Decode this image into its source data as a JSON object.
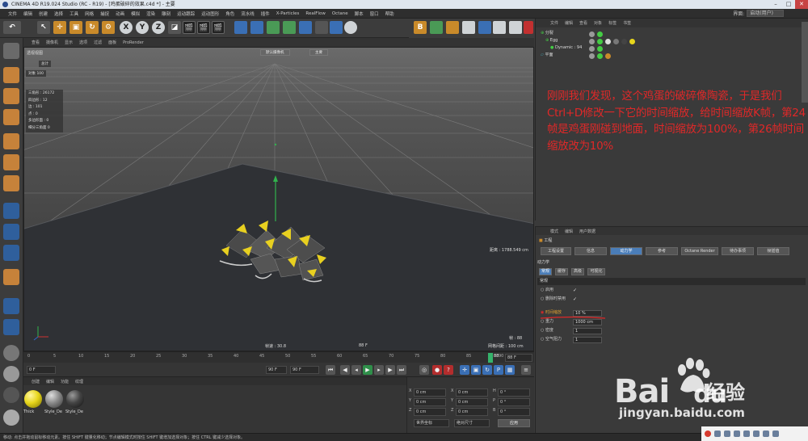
{
  "window": {
    "title": "CINEMA 4D R19.024 Studio (RC - R19) - [鸡蛋破碎的效果.c4d *] - 主要"
  },
  "menubar": {
    "items": [
      "文件",
      "编辑",
      "创建",
      "选择",
      "工具",
      "网格",
      "捕捉",
      "动画",
      "模拟",
      "渲染",
      "雕刻",
      "运动跟踪",
      "运动图形",
      "角色",
      "流水线",
      "插件",
      "X-Particles",
      "RealFlow",
      "Octane",
      "脚本",
      "窗口",
      "帮助"
    ],
    "layout_label": "界面:",
    "layout_value": "启动(用户)"
  },
  "toolbar": {
    "axis_labels": [
      "X",
      "Y",
      "Z"
    ]
  },
  "viewport": {
    "menu": [
      "查看",
      "摄像机",
      "显示",
      "选项",
      "过滤",
      "面板",
      "ProRender"
    ],
    "view_name": "透视视图",
    "camera_button": "默认摄像机",
    "main_button": "主要",
    "hud": {
      "total_label": "总计",
      "objects_label": "对象",
      "objects_value": "100",
      "rows": [
        "三角形 : 26172",
        "四边形 : 12",
        "边 : 101",
        "点 : 0",
        "多边形面 : 0",
        "细分三角面 0"
      ]
    },
    "distance": "距离 : 1788.549 cm",
    "fps": "帧速 : 30.8",
    "frame": "88 F",
    "grid": "网格间距 : 100 cm",
    "frame_label": "帧 : 88"
  },
  "timeline": {
    "ticks": [
      "0",
      "5",
      "10",
      "15",
      "20",
      "25",
      "30",
      "35",
      "40",
      "45",
      "50",
      "55",
      "60",
      "65",
      "70",
      "75",
      "80",
      "85",
      "90"
    ],
    "current": "88",
    "end": "88 F"
  },
  "playbar": {
    "start": "0 F",
    "range_start": "0 F",
    "range_end": "90 F",
    "max": "90 F"
  },
  "materials": {
    "menu": [
      "创建",
      "编辑",
      "功能",
      "纹理"
    ],
    "items": [
      {
        "name": "Thick",
        "color": "#e7d61c"
      },
      {
        "name": "Style_De",
        "color": "#8a8a8a"
      },
      {
        "name": "Style_De",
        "color": "#444444"
      }
    ]
  },
  "coords": {
    "rows": [
      {
        "a": "X",
        "av": "0 cm",
        "b": "X",
        "bv": "0 cm",
        "c": "H",
        "cv": "0 °"
      },
      {
        "a": "Y",
        "av": "0 cm",
        "b": "Y",
        "bv": "0 cm",
        "c": "P",
        "cv": "0 °"
      },
      {
        "a": "Z",
        "av": "0 cm",
        "b": "Z",
        "bv": "0 cm",
        "c": "B",
        "cv": "0 °"
      }
    ],
    "mode": "世界坐标",
    "scale": "绝对尺寸",
    "apply": "应用"
  },
  "statusbar": {
    "text": "移动: 点击并拖动鼠标移动元素。按住 SHIFT 键量化移动；节点编辑模式时按住 SHIFT 键增加选择对象；按住 CTRL 键减少选择对象。"
  },
  "objmgr": {
    "menu": [
      "文件",
      "编辑",
      "查看",
      "对象",
      "标签",
      "书签"
    ],
    "objects": [
      {
        "name": "分裂",
        "indent": 0
      },
      {
        "name": "Egg",
        "indent": 1
      },
      {
        "name": "Dynamic : 94",
        "indent": 2
      },
      {
        "name": "平面",
        "indent": 0
      }
    ]
  },
  "annotation": {
    "text": "刚刚我们发现，这个鸡蛋的破碎像陶瓷，于是我们Ctrl+D修改一下它的时间缩放，给时间缩放K帧，第24帧是鸡蛋刚碰到地面，时间缩放为100%，第26帧时间缩放改为10%"
  },
  "attr": {
    "menu": [
      "模式",
      "编辑",
      "用户数据"
    ],
    "object": "工程",
    "tabs_row1": [
      "工程设置",
      "信息",
      "动力学",
      "参考",
      "Octane Render",
      "待办事项",
      "帧插值"
    ],
    "section": "动力学",
    "subtabs": [
      "常规",
      "缓存",
      "高级",
      "可视化"
    ],
    "group": "常规",
    "props": [
      {
        "label": "启用",
        "value": "✓"
      },
      {
        "label": "删除时禁用",
        "value": "✓"
      }
    ],
    "fields": [
      {
        "label": "时间缩放",
        "value": "10 %"
      },
      {
        "label": "重力",
        "value": "1000 cm"
      },
      {
        "label": "密度",
        "value": "1"
      },
      {
        "label": "空气阻力",
        "value": "1"
      }
    ]
  },
  "watermark": {
    "brand1": "Bai",
    "brand2": "du",
    "suffix": "经验",
    "url": "jingyan.baidu.com"
  },
  "colors": {
    "accent": "#4a7db8",
    "annotation": "#e02828",
    "timeline_cursor": "#35b36b"
  }
}
